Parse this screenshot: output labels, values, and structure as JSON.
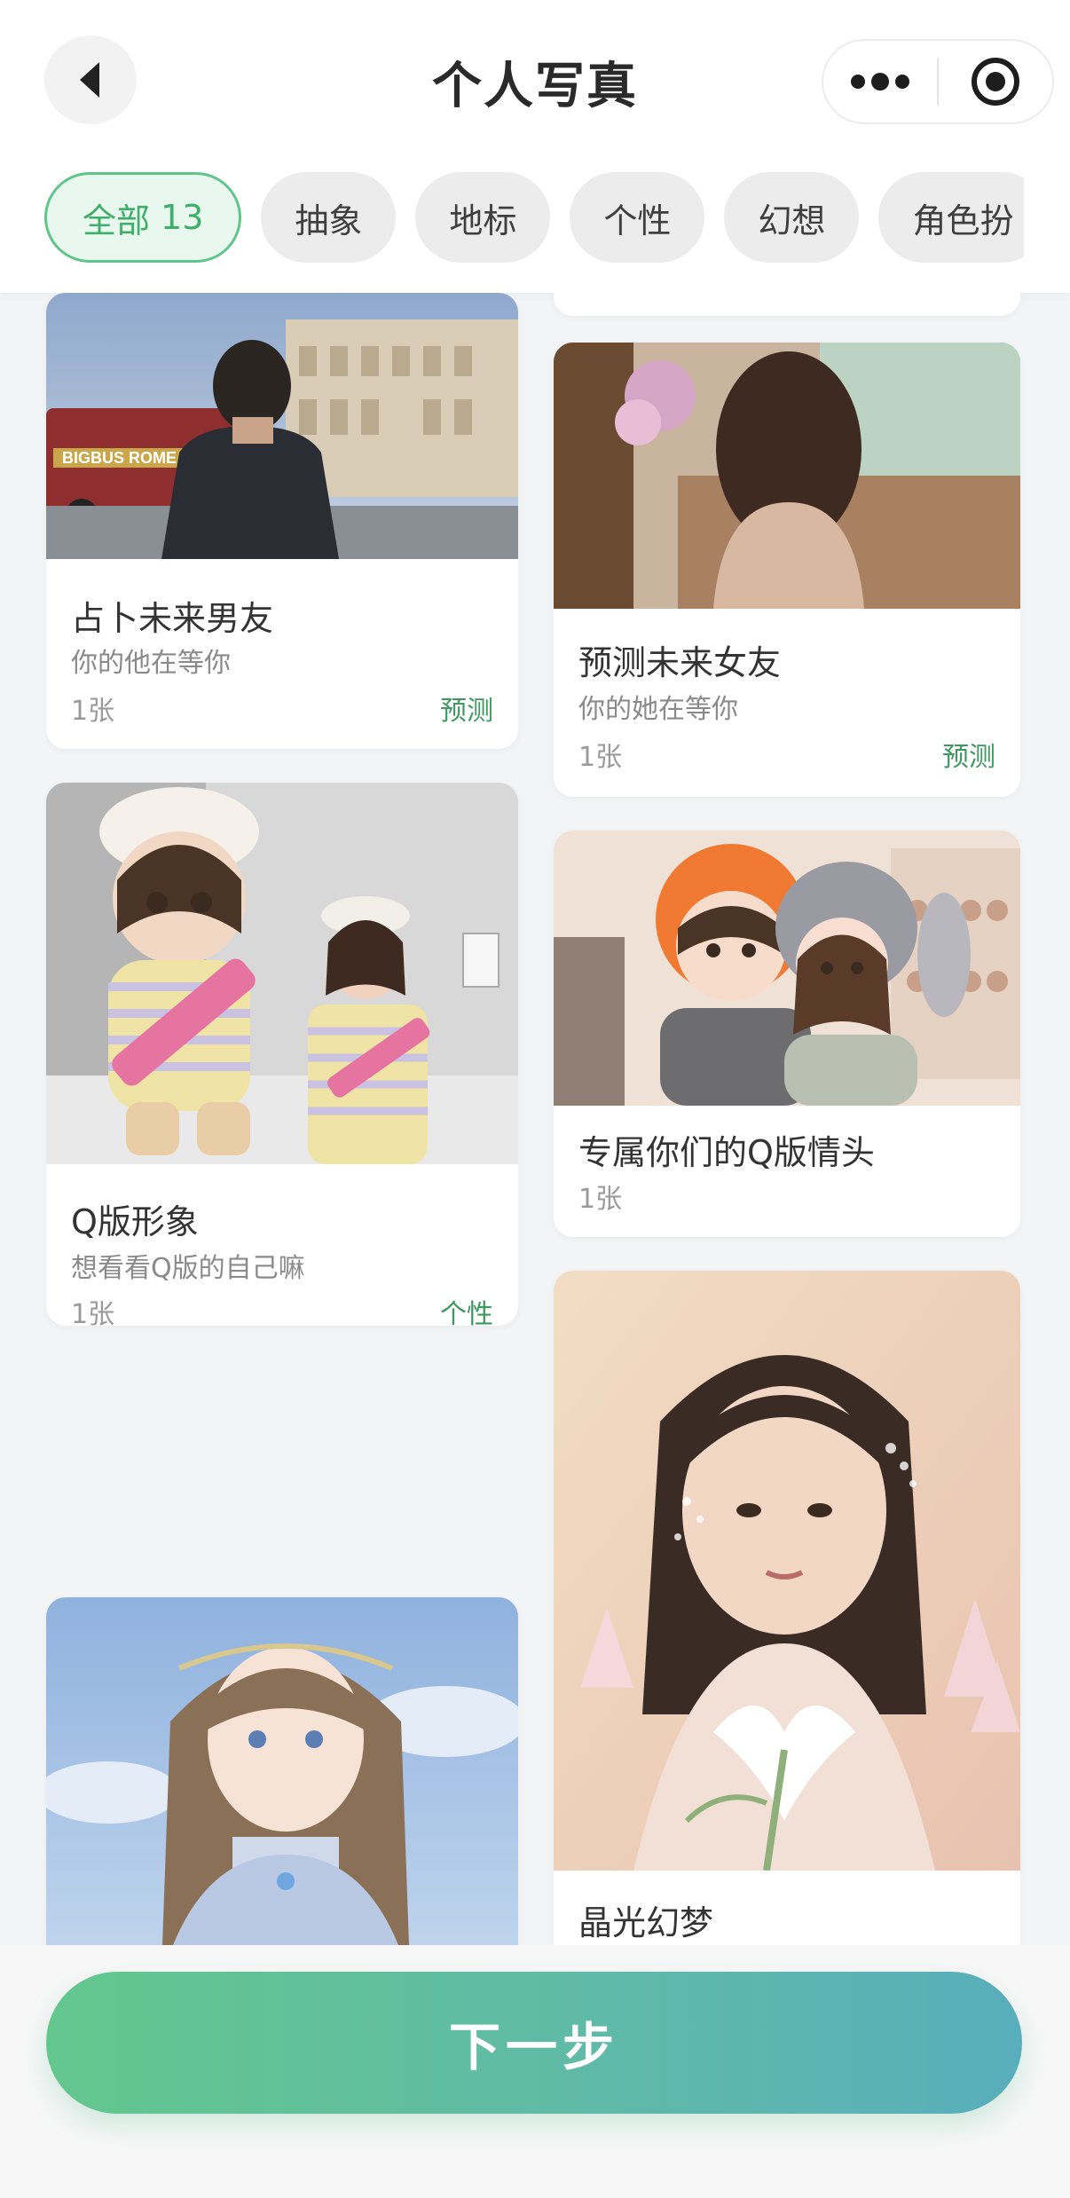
{
  "header": {
    "title": "个人写真"
  },
  "filters": {
    "active_label": "全部",
    "active_count": "13",
    "items": [
      "抽象",
      "地标",
      "个性",
      "幻想",
      "角色扮"
    ]
  },
  "cards": [
    {
      "title": "占卜未来男友",
      "subtitle": "你的他在等你",
      "count": "1张",
      "tag": "预测"
    },
    {
      "title": "预测未来女友",
      "subtitle": "你的她在等你",
      "count": "1张",
      "tag": "预测"
    },
    {
      "title": "专属你们的Q版情头",
      "count": "1张"
    },
    {
      "title": "Q版形象",
      "subtitle": "想看看Q版的自己嘛",
      "count": "1张",
      "tag": "个性"
    },
    {
      "title": "晶光幻梦"
    }
  ],
  "footer": {
    "next_label": "下一步"
  },
  "colors": {
    "accent_green": "#3fae6a",
    "button_start": "#63c78d",
    "button_end": "#58aebb"
  }
}
